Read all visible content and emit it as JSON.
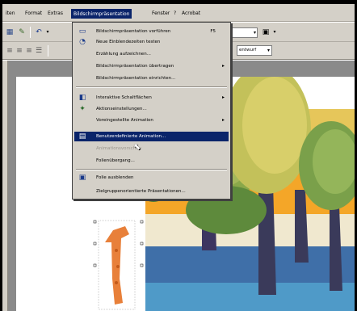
{
  "menubar": {
    "items": [
      "iten",
      "Format",
      "Extras",
      "Bildschirmpräsentation",
      "Fenster",
      "?",
      "Acrobat"
    ]
  },
  "toolbar": {
    "zoom_value": "",
    "design_label": "entwurf"
  },
  "dropdown": {
    "items": [
      {
        "label": "Bildschirmpräsentation vorführen",
        "shortcut": "F5",
        "icon": "screen-icon",
        "submenu": false,
        "state": "normal"
      },
      {
        "label": "Neue Einblendezeiten testen",
        "shortcut": "",
        "icon": "timing-icon",
        "submenu": false,
        "state": "normal"
      },
      {
        "label": "Erzählung aufzeichnen...",
        "shortcut": "",
        "icon": "",
        "submenu": false,
        "state": "normal"
      },
      {
        "label": "Bildschirmpräsentation übertragen",
        "shortcut": "",
        "icon": "",
        "submenu": true,
        "state": "normal"
      },
      {
        "label": "Bildschirmpräsentation einrichten...",
        "shortcut": "",
        "icon": "",
        "submenu": false,
        "state": "normal"
      },
      {
        "label": "Interaktive Schaltflächen",
        "shortcut": "",
        "icon": "buttons-icon",
        "submenu": true,
        "state": "normal"
      },
      {
        "label": "Aktionseinstellungen...",
        "shortcut": "",
        "icon": "action-icon",
        "submenu": false,
        "state": "normal"
      },
      {
        "label": "Voreingestellte Animation",
        "shortcut": "",
        "icon": "",
        "submenu": true,
        "state": "normal"
      },
      {
        "label": "Benutzerdefinierte Animation...",
        "shortcut": "",
        "icon": "animation-icon",
        "submenu": false,
        "state": "highlighted"
      },
      {
        "label": "Animationsvorschau",
        "shortcut": "",
        "icon": "",
        "submenu": false,
        "state": "disabled"
      },
      {
        "label": "Folienübergang...",
        "shortcut": "",
        "icon": "",
        "submenu": false,
        "state": "normal"
      },
      {
        "label": "Folie ausblenden",
        "shortcut": "",
        "icon": "hide-slide-icon",
        "submenu": false,
        "state": "normal"
      },
      {
        "label": "Zielgruppenorientierte Präsentationen...",
        "shortcut": "",
        "icon": "",
        "submenu": false,
        "state": "normal"
      }
    ]
  }
}
